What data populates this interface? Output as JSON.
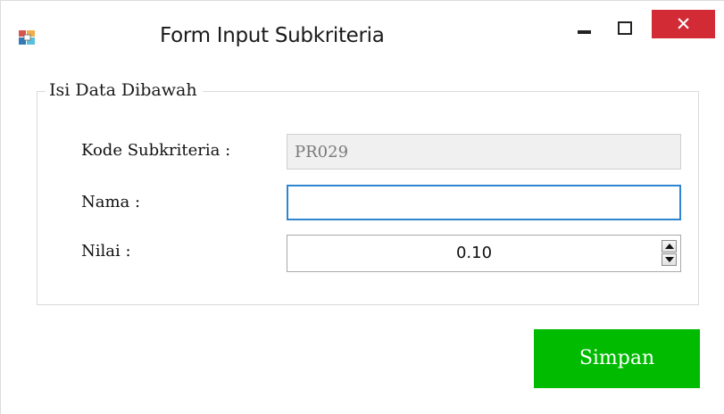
{
  "window": {
    "title": "Form Input Subkriteria",
    "close_symbol": "✕",
    "icons": [
      "app-icon",
      "minimize-icon",
      "maximize-icon",
      "close-icon"
    ]
  },
  "groupbox": {
    "legend": "Isi Data Dibawah"
  },
  "form": {
    "kode_label": "Kode Subkriteria :",
    "kode_value": "PR029",
    "nama_label": "Nama :",
    "nama_value": "",
    "nilai_label": "Nilai :",
    "nilai_value": "0.10"
  },
  "actions": {
    "save_label": "Simpan"
  },
  "colors": {
    "close_button": "#d22b35",
    "save_button": "#00bb00",
    "focus_border": "#2f86d0"
  }
}
